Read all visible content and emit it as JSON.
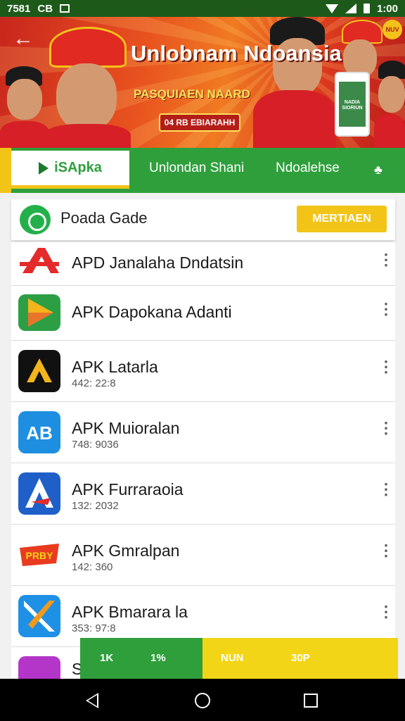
{
  "status_bar": {
    "time_left": "7581",
    "icon_a": "CB",
    "time_right": "1:00"
  },
  "banner": {
    "title": "Unlobnam Ndoansia",
    "subtitle": "PASQUIAEN NAARD",
    "button": "04 RB EBIARAHH",
    "phone_text": "NADIA SIORIUN",
    "corner_badge": "NUV"
  },
  "tabs": {
    "active": "iSApka",
    "items": [
      "Unlondan Shani",
      "Ndoalehse"
    ]
  },
  "header": {
    "title": "Poada Gade",
    "button": "MERTIAEN"
  },
  "apps": [
    {
      "name": "APD Janalaha Dndatsin",
      "meta": "",
      "color": "#e32b2b"
    },
    {
      "name": "APK Dapokana Adanti",
      "meta": "",
      "color": "#2c9f45"
    },
    {
      "name": "APK Latarla",
      "meta": "442: 22:8",
      "color": "#111111"
    },
    {
      "name": "APK Muioralan",
      "meta": "748: 9036",
      "color": "#1e8fe0"
    },
    {
      "name": "APK Furraraoia",
      "meta": "132: 2032",
      "color": "#1f5fc8"
    },
    {
      "name": "APK Gmralpan",
      "meta": "142: 360",
      "color": "#e93b1f"
    },
    {
      "name": "APK Bmarara la",
      "meta": "353: 97:8",
      "color": "#1e90e6"
    },
    {
      "name": "S",
      "meta": "",
      "color": "#b436c9"
    }
  ],
  "promo": {
    "a": "1K",
    "b": "1%",
    "c": "NUN",
    "d": "30P"
  }
}
